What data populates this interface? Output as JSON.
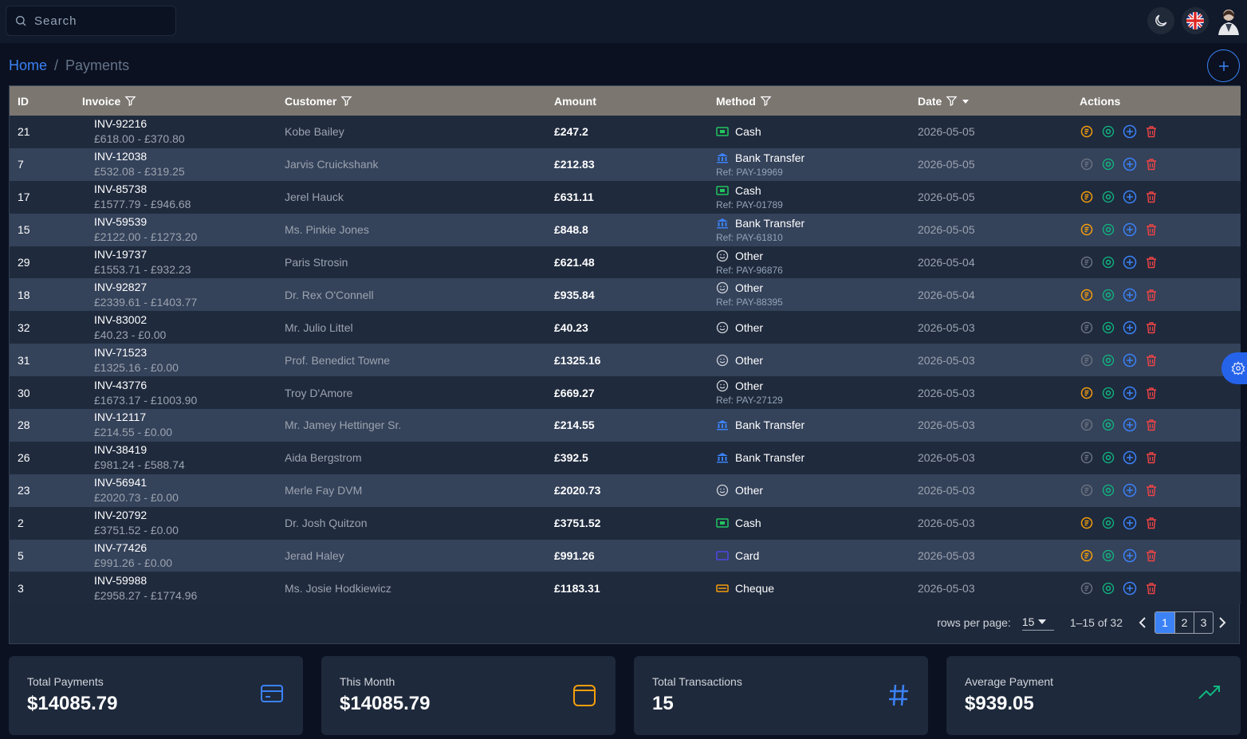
{
  "search": {
    "placeholder": "Search"
  },
  "breadcrumb": {
    "home": "Home",
    "separator": "/",
    "current": "Payments"
  },
  "table": {
    "headers": {
      "id": "ID",
      "invoice": "Invoice",
      "customer": "Customer",
      "amount": "Amount",
      "method": "Method",
      "date": "Date",
      "actions": "Actions"
    },
    "rows": [
      {
        "id": "21",
        "invoice": "INV-92216",
        "range": "£618.00 - £370.80",
        "customer": "Kobe Bailey",
        "amount": "£247.2",
        "method": "Cash",
        "ref": "",
        "date": "2026-05-05",
        "receipt_active": true
      },
      {
        "id": "7",
        "invoice": "INV-12038",
        "range": "£532.08 - £319.25",
        "customer": "Jarvis Cruickshank",
        "amount": "£212.83",
        "method": "Bank Transfer",
        "ref": "Ref: PAY-19969",
        "date": "2026-05-05",
        "receipt_active": false
      },
      {
        "id": "17",
        "invoice": "INV-85738",
        "range": "£1577.79 - £946.68",
        "customer": "Jerel Hauck",
        "amount": "£631.11",
        "method": "Cash",
        "ref": "Ref: PAY-01789",
        "date": "2026-05-05",
        "receipt_active": true
      },
      {
        "id": "15",
        "invoice": "INV-59539",
        "range": "£2122.00 - £1273.20",
        "customer": "Ms. Pinkie Jones",
        "amount": "£848.8",
        "method": "Bank Transfer",
        "ref": "Ref: PAY-61810",
        "date": "2026-05-05",
        "receipt_active": true
      },
      {
        "id": "29",
        "invoice": "INV-19737",
        "range": "£1553.71 - £932.23",
        "customer": "Paris Strosin",
        "amount": "£621.48",
        "method": "Other",
        "ref": "Ref: PAY-96876",
        "date": "2026-05-04",
        "receipt_active": false
      },
      {
        "id": "18",
        "invoice": "INV-92827",
        "range": "£2339.61 - £1403.77",
        "customer": "Dr. Rex O'Connell",
        "amount": "£935.84",
        "method": "Other",
        "ref": "Ref: PAY-88395",
        "date": "2026-05-04",
        "receipt_active": true
      },
      {
        "id": "32",
        "invoice": "INV-83002",
        "range": "£40.23 - £0.00",
        "customer": "Mr. Julio Littel",
        "amount": "£40.23",
        "method": "Other",
        "ref": "",
        "date": "2026-05-03",
        "receipt_active": false
      },
      {
        "id": "31",
        "invoice": "INV-71523",
        "range": "£1325.16 - £0.00",
        "customer": "Prof. Benedict Towne",
        "amount": "£1325.16",
        "method": "Other",
        "ref": "",
        "date": "2026-05-03",
        "receipt_active": false
      },
      {
        "id": "30",
        "invoice": "INV-43776",
        "range": "£1673.17 - £1003.90",
        "customer": "Troy D'Amore",
        "amount": "£669.27",
        "method": "Other",
        "ref": "Ref: PAY-27129",
        "date": "2026-05-03",
        "receipt_active": true
      },
      {
        "id": "28",
        "invoice": "INV-12117",
        "range": "£214.55 - £0.00",
        "customer": "Mr. Jamey Hettinger Sr.",
        "amount": "£214.55",
        "method": "Bank Transfer",
        "ref": "",
        "date": "2026-05-03",
        "receipt_active": false
      },
      {
        "id": "26",
        "invoice": "INV-38419",
        "range": "£981.24 - £588.74",
        "customer": "Aida Bergstrom",
        "amount": "£392.5",
        "method": "Bank Transfer",
        "ref": "",
        "date": "2026-05-03",
        "receipt_active": false
      },
      {
        "id": "23",
        "invoice": "INV-56941",
        "range": "£2020.73 - £0.00",
        "customer": "Merle Fay DVM",
        "amount": "£2020.73",
        "method": "Other",
        "ref": "",
        "date": "2026-05-03",
        "receipt_active": false
      },
      {
        "id": "2",
        "invoice": "INV-20792",
        "range": "£3751.52 - £0.00",
        "customer": "Dr. Josh Quitzon",
        "amount": "£3751.52",
        "method": "Cash",
        "ref": "",
        "date": "2026-05-03",
        "receipt_active": true
      },
      {
        "id": "5",
        "invoice": "INV-77426",
        "range": "£991.26 - £0.00",
        "customer": "Jerad Haley",
        "amount": "£991.26",
        "method": "Card",
        "ref": "",
        "date": "2026-05-03",
        "receipt_active": true
      },
      {
        "id": "3",
        "invoice": "INV-59988",
        "range": "£2958.27 - £1774.96",
        "customer": "Ms. Josie Hodkiewicz",
        "amount": "£1183.31",
        "method": "Cheque",
        "ref": "",
        "date": "2026-05-03",
        "receipt_active": false
      }
    ]
  },
  "pagination": {
    "rows_per_page_label": "rows per page:",
    "rows_per_page": "15",
    "range": "1–15 of 32",
    "pages": [
      "1",
      "2",
      "3"
    ],
    "current_page": "1"
  },
  "stats": [
    {
      "label": "Total Payments",
      "value": "$14085.79",
      "icon": "credit-card-icon"
    },
    {
      "label": "This Month",
      "value": "$14085.79",
      "icon": "calendar-icon"
    },
    {
      "label": "Total Transactions",
      "value": "15",
      "icon": "hash-icon"
    },
    {
      "label": "Average Payment",
      "value": "$939.05",
      "icon": "trending-up-icon"
    }
  ],
  "colors": {
    "accent": "#3b82f6",
    "header_row": "#7b7670",
    "receipt": "#f59e0b",
    "view": "#10b981",
    "delete": "#ef4444",
    "cash": "#22c55e",
    "bank": "#3b82f6",
    "cheque": "#f59e0b"
  }
}
